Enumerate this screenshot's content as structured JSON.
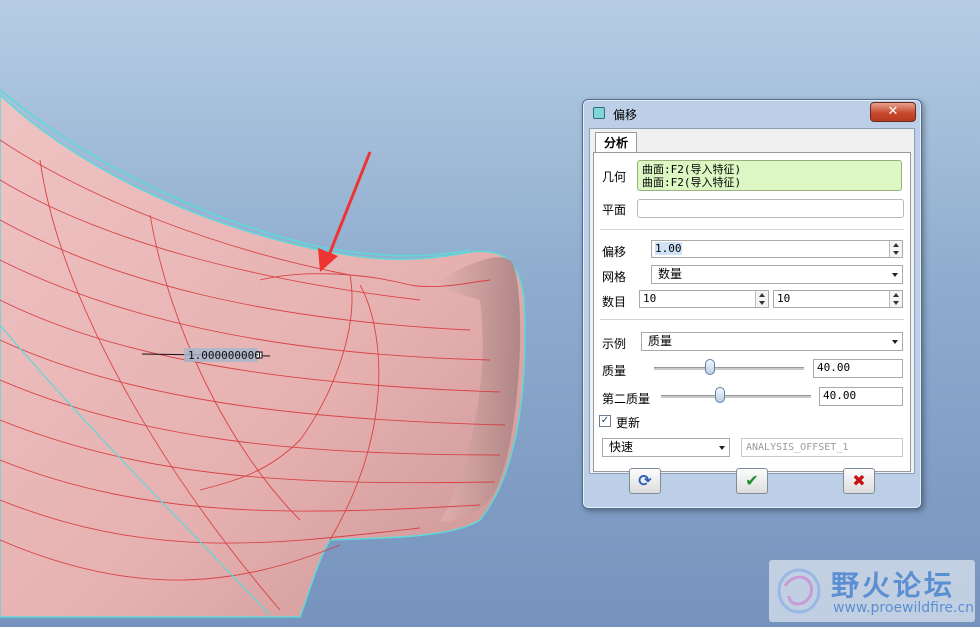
{
  "dialog": {
    "title": "偏移",
    "close_glyph": "✕",
    "tab_label": "分析",
    "geometry": {
      "label": "几何",
      "refs": [
        "曲面:F2(导入特征)",
        "曲面:F2(导入特征)"
      ]
    },
    "plane": {
      "label": "平面",
      "value": ""
    },
    "offset": {
      "label": "偏移",
      "value": "1.00"
    },
    "mesh": {
      "label": "网格",
      "selected": "数量"
    },
    "count": {
      "label": "数目",
      "value_1": "10",
      "value_2": "10"
    },
    "display": {
      "label": "示例",
      "selected": "质量"
    },
    "quality": {
      "label": "质量",
      "value": "40.00",
      "slider_level": 0.37
    },
    "quality2": {
      "label": "第二质量",
      "value": "40.00",
      "slider_level": 0.39
    },
    "update": {
      "label": "更新",
      "checked": true,
      "check_glyph": "✓"
    },
    "mode": {
      "selected": "快速"
    },
    "feature_name": {
      "placeholder": "ANALYSIS_OFFSET_1"
    },
    "buttons": {
      "refresh_glyph": "⟳",
      "ok_glyph": "✔",
      "cancel_glyph": "✖"
    }
  },
  "viewport": {
    "marker_text": "1.000000000"
  },
  "watermark": {
    "name": "野火论坛",
    "url": "www.proewildfire.cn"
  },
  "colors": {
    "surface": "#e8b2b2",
    "mesh_lines": "#d8383a",
    "edge": "#5fd8d8",
    "arrow": "#ef3333",
    "dialog_frame": "#bccfe6",
    "geometry_highlight": "#dcf7c3"
  }
}
